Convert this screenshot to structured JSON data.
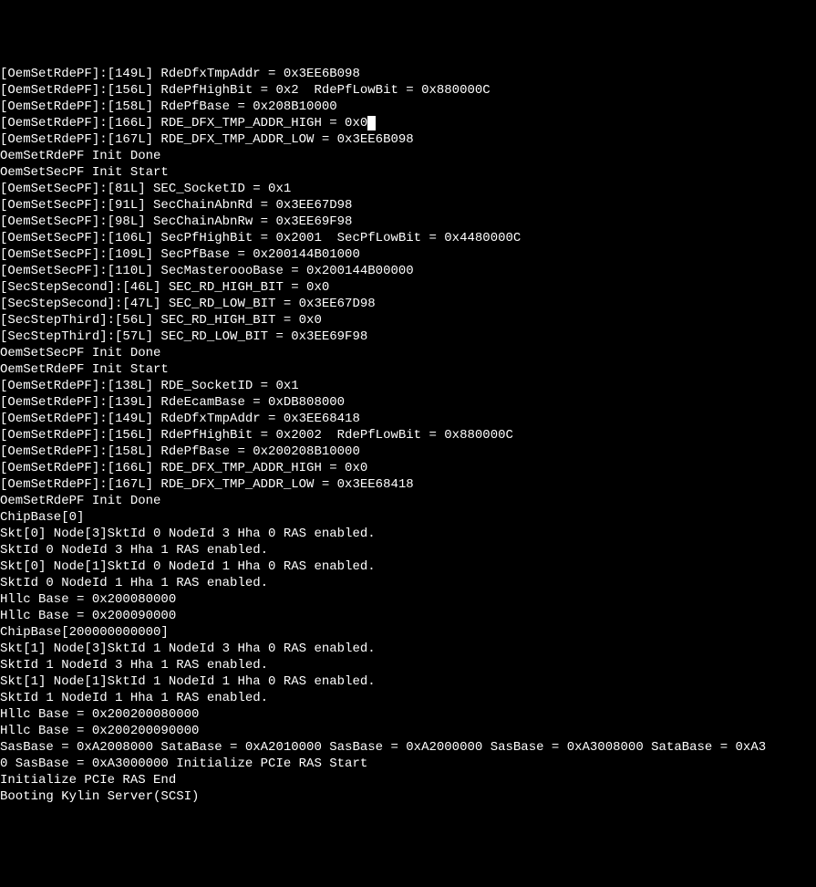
{
  "lines": [
    "[OemSetRdePF]:[149L] RdeDfxTmpAddr = 0x3EE6B098",
    "[OemSetRdePF]:[156L] RdePfHighBit = 0x2  RdePfLowBit = 0x880000C",
    "[OemSetRdePF]:[158L] RdePfBase = 0x208B10000",
    "[OemSetRdePF]:[166L] RDE_DFX_TMP_ADDR_HIGH = 0x0",
    "[OemSetRdePF]:[167L] RDE_DFX_TMP_ADDR_LOW = 0x3EE6B098",
    "OemSetRdePF Init Done",
    "OemSetSecPF Init Start",
    "[OemSetSecPF]:[81L] SEC_SocketID = 0x1",
    "[OemSetSecPF]:[91L] SecChainAbnRd = 0x3EE67D98",
    "[OemSetSecPF]:[98L] SecChainAbnRw = 0x3EE69F98",
    "[OemSetSecPF]:[106L] SecPfHighBit = 0x2001  SecPfLowBit = 0x4480000C",
    "[OemSetSecPF]:[109L] SecPfBase = 0x200144B01000",
    "[OemSetSecPF]:[110L] SecMasteroooBase = 0x200144B00000",
    "[SecStepSecond]:[46L] SEC_RD_HIGH_BIT = 0x0",
    "[SecStepSecond]:[47L] SEC_RD_LOW_BIT = 0x3EE67D98",
    "[SecStepThird]:[56L] SEC_RD_HIGH_BIT = 0x0",
    "[SecStepThird]:[57L] SEC_RD_LOW_BIT = 0x3EE69F98",
    "OemSetSecPF Init Done",
    "OemSetRdePF Init Start",
    "[OemSetRdePF]:[138L] RDE_SocketID = 0x1",
    "[OemSetRdePF]:[139L] RdeEcamBase = 0xDB808000",
    "[OemSetRdePF]:[149L] RdeDfxTmpAddr = 0x3EE68418",
    "[OemSetRdePF]:[156L] RdePfHighBit = 0x2002  RdePfLowBit = 0x880000C",
    "[OemSetRdePF]:[158L] RdePfBase = 0x200208B10000",
    "[OemSetRdePF]:[166L] RDE_DFX_TMP_ADDR_HIGH = 0x0",
    "[OemSetRdePF]:[167L] RDE_DFX_TMP_ADDR_LOW = 0x3EE68418",
    "OemSetRdePF Init Done",
    "ChipBase[0]",
    "Skt[0] Node[3]SktId 0 NodeId 3 Hha 0 RAS enabled.",
    "SktId 0 NodeId 3 Hha 1 RAS enabled.",
    "Skt[0] Node[1]SktId 0 NodeId 1 Hha 0 RAS enabled.",
    "SktId 0 NodeId 1 Hha 1 RAS enabled.",
    "Hllc Base = 0x200080000",
    "Hllc Base = 0x200090000",
    "ChipBase[200000000000]",
    "Skt[1] Node[3]SktId 1 NodeId 3 Hha 0 RAS enabled.",
    "SktId 1 NodeId 3 Hha 1 RAS enabled.",
    "Skt[1] Node[1]SktId 1 NodeId 1 Hha 0 RAS enabled.",
    "SktId 1 NodeId 1 Hha 1 RAS enabled.",
    "Hllc Base = 0x200200080000",
    "Hllc Base = 0x200200090000",
    "SasBase = 0xA2008000 SataBase = 0xA2010000 SasBase = 0xA2000000 SasBase = 0xA3008000 SataBase = 0xA3",
    "0 SasBase = 0xA3000000 Initialize PCIe RAS Start",
    "Initialize PCIe RAS End",
    "Booting Kylin Server(SCSI)"
  ],
  "cursor_line_index": 3,
  "cursor_char_index": 53
}
